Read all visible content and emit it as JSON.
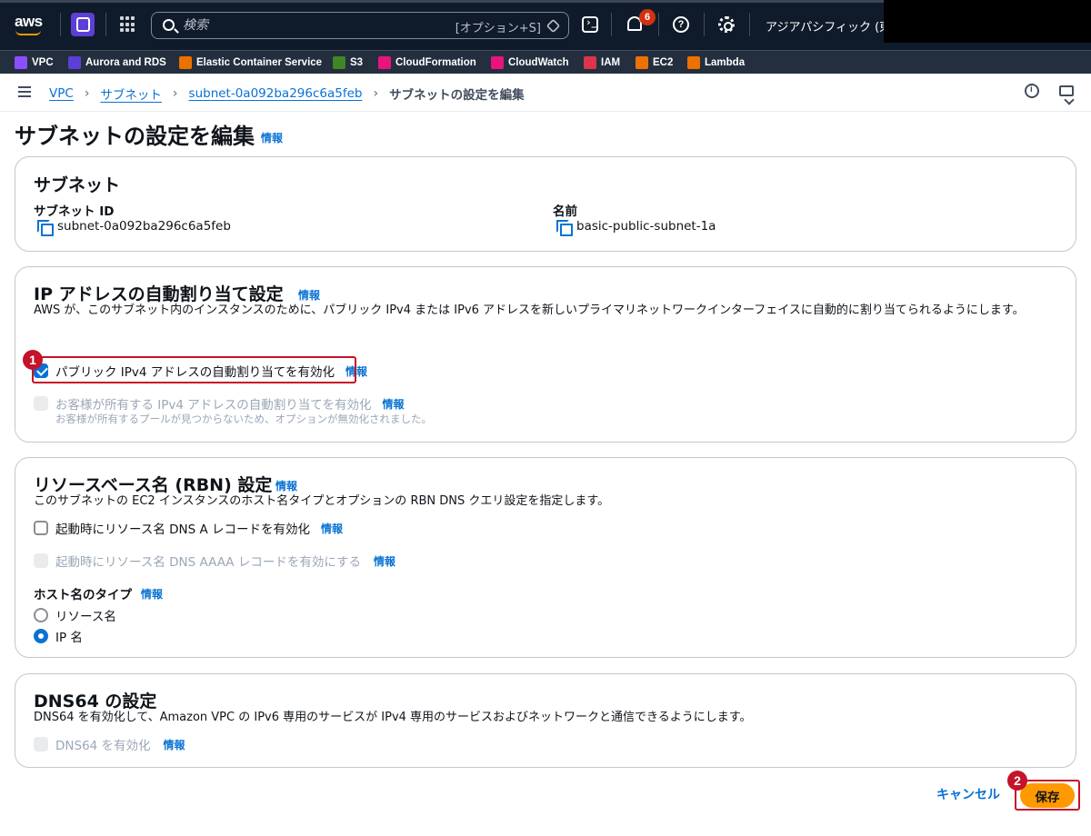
{
  "topbar": {
    "logo_text": "aws",
    "search_placeholder": "検索",
    "search_shortcut": "[オプション+S]",
    "notification_count": "6",
    "region": "アジアパシフィック (東京)"
  },
  "favorites": [
    {
      "label": "VPC",
      "color": "#8c4fff"
    },
    {
      "label": "Aurora and RDS",
      "color": "#5b3fd6"
    },
    {
      "label": "Elastic Container Service",
      "color": "#ed7100"
    },
    {
      "label": "S3",
      "color": "#3f8624"
    },
    {
      "label": "CloudFormation",
      "color": "#e7157b"
    },
    {
      "label": "CloudWatch",
      "color": "#e7157b"
    },
    {
      "label": "IAM",
      "color": "#dd344c"
    },
    {
      "label": "EC2",
      "color": "#ed7100"
    },
    {
      "label": "Lambda",
      "color": "#ed7100"
    }
  ],
  "breadcrumb": {
    "items": [
      "VPC",
      "サブネット",
      "subnet-0a092ba296c6a5feb"
    ],
    "current": "サブネットの設定を編集"
  },
  "page": {
    "title": "サブネットの設定を編集",
    "info": "情報"
  },
  "subnet_card": {
    "title": "サブネット",
    "id_label": "サブネット ID",
    "id_value": "subnet-0a092ba296c6a5feb",
    "name_label": "名前",
    "name_value": "basic-public-subnet-1a"
  },
  "ip_card": {
    "title": "IP アドレスの自動割り当て設定",
    "info": "情報",
    "description": "AWS が、このサブネット内のインスタンスのために、パブリック IPv4 または IPv6 アドレスを新しいプライマリネットワークインターフェイスに自動的に割り当てられるようにします。",
    "public_ipv4_label": "パブリック IPv4 アドレスの自動割り当てを有効化",
    "public_ipv4_checked": true,
    "customer_ipv4_label": "お客様が所有する IPv4 アドレスの自動割り当てを有効化",
    "customer_ipv4_hint": "お客様が所有するプールが見つからないため、オプションが無効化されました。"
  },
  "rbn_card": {
    "title": "リソースベース名 (RBN) 設定",
    "info": "情報",
    "description": "このサブネットの EC2 インスタンスのホスト名タイプとオプションの RBN DNS クエリ設定を指定します。",
    "dns_a_label": "起動時にリソース名 DNS A レコードを有効化",
    "dns_aaaa_label": "起動時にリソース名 DNS AAAA レコードを有効にする",
    "hostname_type_label": "ホスト名のタイプ",
    "option_resource_name": "リソース名",
    "option_ip_name": "IP 名",
    "selected_option": "IP 名"
  },
  "dns64_card": {
    "title": "DNS64 の設定",
    "description": "DNS64 を有効化して、Amazon VPC の IPv6 専用のサービスが IPv4 専用のサービスおよびネットワークと通信できるようにします。",
    "enable_label": "DNS64 を有効化",
    "info": "情報"
  },
  "actions": {
    "cancel": "キャンセル",
    "save": "保存"
  },
  "annotations": {
    "step1": "1",
    "step2": "2",
    "highlight_color": "#c4132a"
  }
}
